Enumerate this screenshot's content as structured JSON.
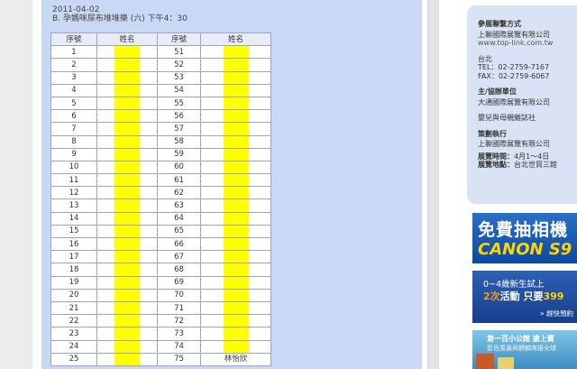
{
  "header": {
    "date": "2011-04-02",
    "subtitle": "B. 孕媽咪尿布堆堆樂 (六) 下午4：30"
  },
  "table": {
    "headers": [
      "序號",
      "姓名",
      "序號",
      "姓名"
    ],
    "rows": [
      {
        "left": "1",
        "right": "51",
        "right_name": ""
      },
      {
        "left": "2",
        "right": "52",
        "right_name": ""
      },
      {
        "left": "3",
        "right": "53",
        "right_name": ""
      },
      {
        "left": "4",
        "right": "54",
        "right_name": ""
      },
      {
        "left": "5",
        "right": "55",
        "right_name": ""
      },
      {
        "left": "6",
        "right": "56",
        "right_name": ""
      },
      {
        "left": "7",
        "right": "57",
        "right_name": ""
      },
      {
        "left": "8",
        "right": "58",
        "right_name": ""
      },
      {
        "left": "9",
        "right": "59",
        "right_name": ""
      },
      {
        "left": "10",
        "right": "60",
        "right_name": ""
      },
      {
        "left": "11",
        "right": "61",
        "right_name": ""
      },
      {
        "left": "12",
        "right": "62",
        "right_name": ""
      },
      {
        "left": "13",
        "right": "63",
        "right_name": ""
      },
      {
        "left": "14",
        "right": "64",
        "right_name": ""
      },
      {
        "left": "15",
        "right": "65",
        "right_name": ""
      },
      {
        "left": "16",
        "right": "66",
        "right_name": ""
      },
      {
        "left": "17",
        "right": "67",
        "right_name": ""
      },
      {
        "left": "18",
        "right": "68",
        "right_name": ""
      },
      {
        "left": "19",
        "right": "69",
        "right_name": ""
      },
      {
        "left": "20",
        "right": "70",
        "right_name": ""
      },
      {
        "left": "21",
        "right": "71",
        "right_name": ""
      },
      {
        "left": "22",
        "right": "72",
        "right_name": ""
      },
      {
        "left": "23",
        "right": "73",
        "right_name": ""
      },
      {
        "left": "24",
        "right": "74",
        "right_name": ""
      },
      {
        "left": "25",
        "right": "75",
        "right_name": "林怡欣"
      }
    ]
  },
  "sidebar": {
    "contact_title": "參展聯繫方式",
    "contact_company": "上聯國際展覽有限公司",
    "contact_url": "www.top-link.com.tw",
    "contact_city": "台北",
    "contact_tel": "TEL：02-2759-7167",
    "contact_fax": "FAX：02-2759-6067",
    "organizer_title": "主/協辦單位",
    "organizer_1": "大通國際展覽有限公司",
    "organizer_2": "嬰兒與母親雜誌社",
    "executor_title": "策劃執行",
    "executor_company": "上聯國際展覽有限公司",
    "time_label": "展覽時間：",
    "time_value": "4月1～4日",
    "place_label": "展覽地點：",
    "place_value": "台北世貿三館"
  },
  "ads": {
    "ad1_line1": "免費抽相機",
    "ad1_line2": "CANON S9",
    "ad2_line1": "0~4歲新生試上",
    "ad2_line2_a": "2次",
    "ad2_line2_b": "活動 只要",
    "ad2_line2_c": "399",
    "ad2_line3": "» 趕快預約",
    "ad3_line1": "第一百小公館 搶上寶",
    "ad3_line2": "藍色風暴與麒麟席捲全球"
  }
}
